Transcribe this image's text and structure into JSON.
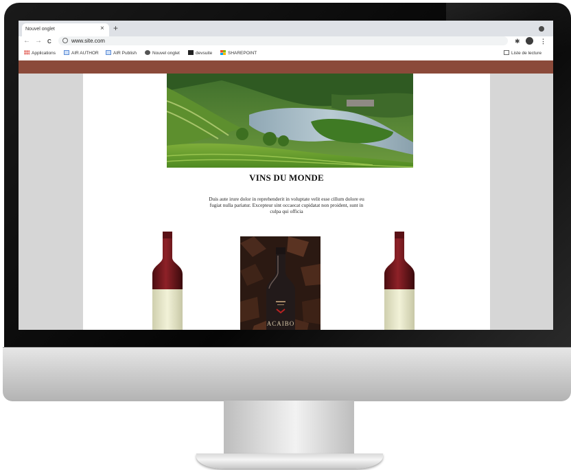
{
  "browser": {
    "tab_title": "Nouvel onglet",
    "tab_close": "×",
    "new_tab": "+",
    "nav": {
      "back": "←",
      "forward": "→",
      "reload": "C"
    },
    "url": "www.site.com",
    "bookmarks": [
      {
        "label": "Applications",
        "icon": "apps-icon"
      },
      {
        "label": "AIR AUTHOR",
        "icon": "air-author-icon"
      },
      {
        "label": "AIR Publish",
        "icon": "air-publish-icon"
      },
      {
        "label": "Nouvel onglet",
        "icon": "globe-icon"
      },
      {
        "label": "devsuite",
        "icon": "devsuite-icon"
      },
      {
        "label": "SHAREPOINT",
        "icon": "sharepoint-icon"
      }
    ],
    "reading_list": "Liste de lecture"
  },
  "page": {
    "banner_color": "#8b4a3a",
    "title": "VINS DU MONDE",
    "description": "Duis aute irure dolor in reprehenderit in voluptate velit esse cillum dolore eu fugiat nulla pariatur. Excepteur sint occaecat cupidatat non proident, sunt in culpa qui officia",
    "products": [
      {
        "name": "red-wine-bottle-left"
      },
      {
        "name": "wine-bottle-center",
        "label": "ACAIBO"
      },
      {
        "name": "red-wine-bottle-right"
      }
    ]
  }
}
